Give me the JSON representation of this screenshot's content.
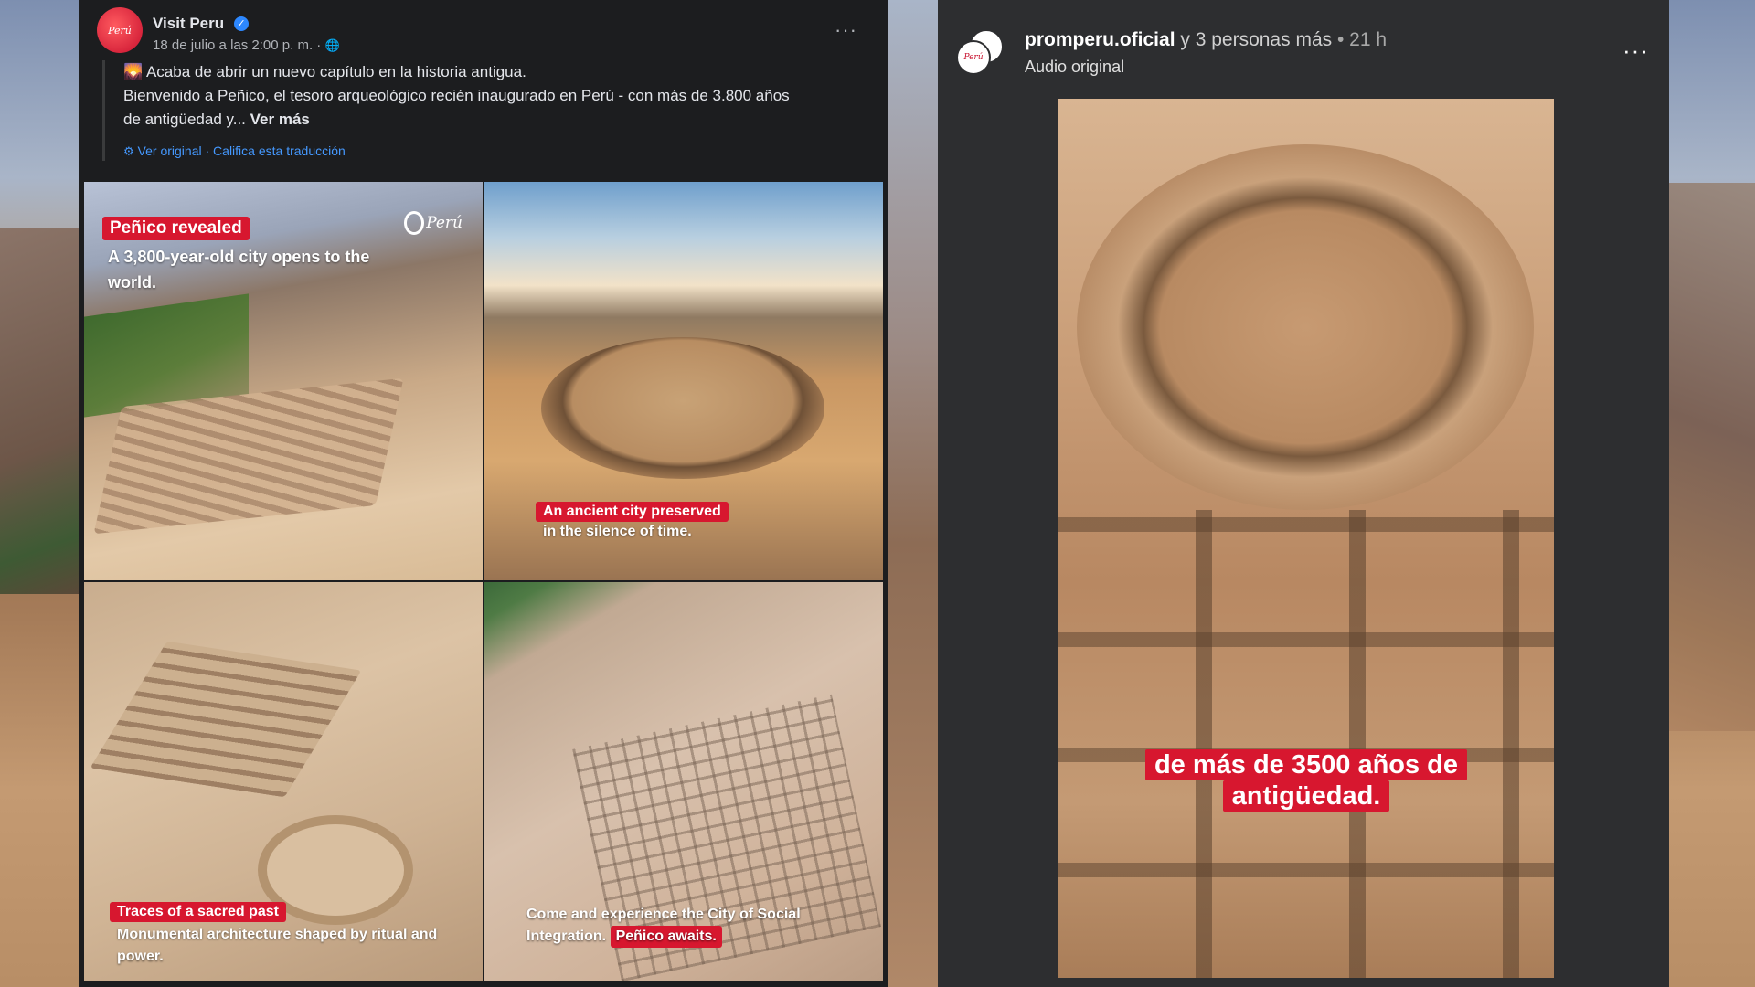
{
  "facebook": {
    "page_name": "Visit Peru",
    "verified_mark": "✓",
    "avatar_text": "Perú",
    "date": "18 de julio a las 2:00 p. m. ·",
    "more": "···",
    "body": {
      "line1": "Acaba de abrir un nuevo capítulo en la historia antigua.",
      "line1_icon": "🌄",
      "line2": "Bienvenido a Peñico, el tesoro arqueológico recién inaugurado en Perú - con más de 3.800 años",
      "line3": "de antigüedad y...",
      "see_more": "Ver más",
      "translate_original": "Ver original",
      "translate_sep": " · ",
      "translate_rate": "Califica esta traducción"
    },
    "tiles": [
      {
        "title": "Peñico revealed",
        "subtitle": "A 3,800-year-old city opens to the world.",
        "logo": "Perú"
      },
      {
        "title": "An ancient city preserved",
        "subtitle": "in the silence of time."
      },
      {
        "title": "Traces of a sacred past",
        "subtitle": "Monumental architecture shaped by ritual and power."
      },
      {
        "subtitle": "Come and experience the City of Social Integration.",
        "highlight": "Peñico awaits."
      }
    ]
  },
  "reel": {
    "username": "promperu.oficial",
    "others": "y 3 personas más",
    "dot": "•",
    "time": "21 h",
    "audio": "Audio original",
    "more": "···",
    "avatar_text": "Perú",
    "caption_line1": "de más de 3500 años de",
    "caption_line2": "antigüedad."
  },
  "colors": {
    "fb_bg": "#1c1d1f",
    "ig_bg": "#2d2e30",
    "accent_red": "#d7172f",
    "link_blue": "#4599ff"
  },
  "icons": {
    "verified": "verified-badge-icon",
    "globe": "globe-icon",
    "gear": "gear-icon",
    "more": "more-options-icon"
  }
}
